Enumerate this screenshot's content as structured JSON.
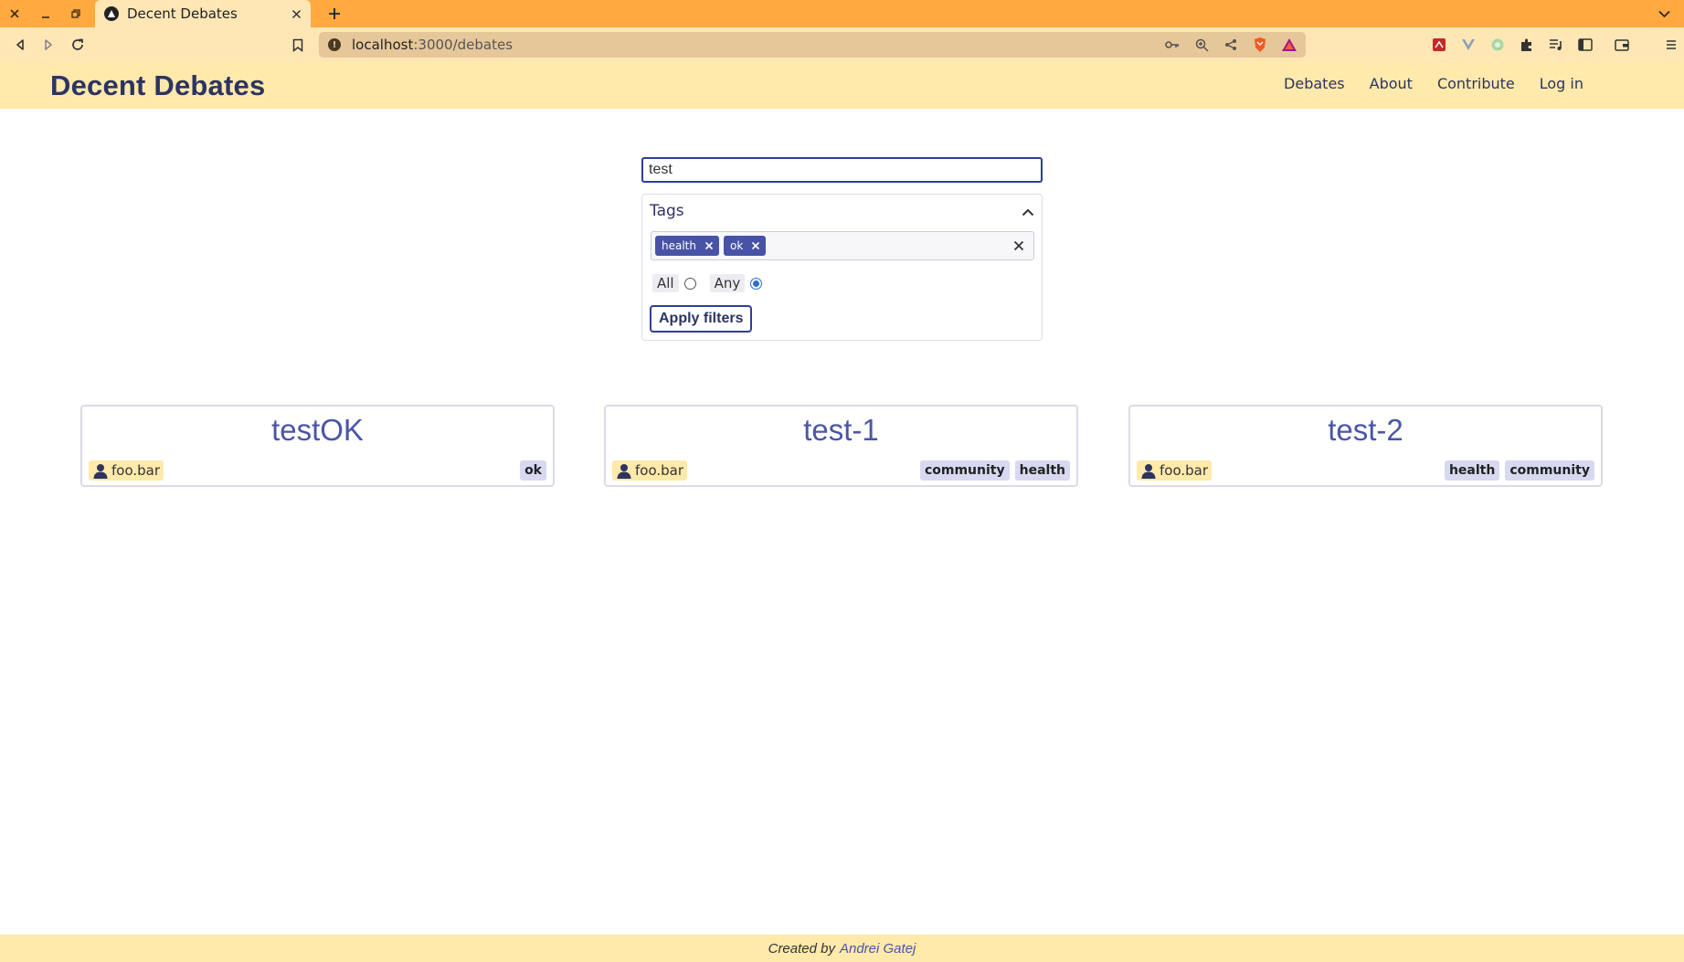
{
  "browser": {
    "tab_title": "Decent Debates",
    "url_host": "localhost",
    "url_path": ":3000/debates"
  },
  "app": {
    "brand": "Decent Debates",
    "nav": [
      "Debates",
      "About",
      "Contribute",
      "Log in"
    ]
  },
  "search": {
    "value": "test"
  },
  "filters": {
    "title": "Tags",
    "chips": [
      "health",
      "ok"
    ],
    "modes": [
      "All",
      "Any"
    ],
    "selected_mode": "Any",
    "apply_label": "Apply filters"
  },
  "debates": [
    {
      "title": "testOK",
      "author": "foo.bar",
      "tags": [
        "ok"
      ]
    },
    {
      "title": "test-1",
      "author": "foo.bar",
      "tags": [
        "community",
        "health"
      ]
    },
    {
      "title": "test-2",
      "author": "foo.bar",
      "tags": [
        "health",
        "community"
      ]
    }
  ],
  "footer": {
    "prefix": "Created by",
    "author": "Andrei Gatej"
  },
  "colors": {
    "tabbar": "#ffa93f",
    "toolbar": "#ffe6b5",
    "header": "#ffe9ab",
    "brand_text": "#2d3461",
    "chip": "#4853a7",
    "card_tag": "#d6d9f0"
  }
}
